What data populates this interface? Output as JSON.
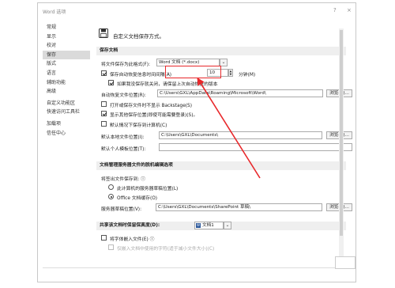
{
  "dialog": {
    "title": "Word 选项",
    "help_glyph": "?",
    "close_glyph": "×"
  },
  "sidebar": {
    "items": [
      {
        "label": "常规",
        "active": false
      },
      {
        "label": "显示",
        "active": false
      },
      {
        "label": "校对",
        "active": false
      },
      {
        "label": "保存",
        "active": true
      },
      {
        "label": "版式",
        "active": false
      },
      {
        "label": "语言",
        "active": false
      },
      {
        "label": "辅助功能",
        "active": false
      },
      {
        "label": "高级",
        "active": false
      },
      {
        "label": "自定义功能区",
        "active": false
      },
      {
        "label": "快速访问工具栏",
        "active": false
      },
      {
        "label": "加载项",
        "active": false
      },
      {
        "label": "信任中心",
        "active": false
      }
    ]
  },
  "header": {
    "text": "自定义文档保存方式。",
    "icon": "save-floppy-icon"
  },
  "save_docs": {
    "section_title": "保存文档",
    "format_label": "将文件保存为此格式(F):",
    "format_value": "Word 文档 (*.docx)",
    "autorecover_label": "保存自动恢复信息时间间隔(A)",
    "autorecover_checked": true,
    "autorecover_minutes": "10",
    "minutes_label": "分钟(M)",
    "keep_last_label": "如果我没保存就关闭，请保留上次自动恢复的版本",
    "keep_last_checked": true,
    "autorecover_location_label": "自动恢复文件位置(R):",
    "autorecover_location_value": "C:\\Users\\GXL\\AppData\\Roaming\\Microsoft\\Word\\",
    "browse_label": "浏览(B)...",
    "no_backstage_label": "打开或保存文件时不显示 Backstage(S)",
    "no_backstage_checked": false,
    "show_other_locations_label": "显示其他保存位置(即使可能需要登录)(S)。",
    "show_other_locations_checked": true,
    "default_to_computer_label": "默认情况下保存到计算机(C)",
    "default_to_computer_checked": false,
    "default_local_label": "默认本地文件位置(I):",
    "default_local_value": "C:\\Users\\GXL\\Documents\\",
    "browse2_label": "浏览(B)...",
    "personal_templates_label": "默认个人模板位置(T):",
    "personal_templates_value": ""
  },
  "server": {
    "section_title": "文档管理服务器文件的脱机编辑选项",
    "checkout_label": "将签出文件保存到: ⓘ",
    "option1_label": "此计算机的服务器草稿位置(L)",
    "option1_selected": false,
    "option2_label": "Office 文档缓存(O)",
    "option2_selected": true,
    "drafts_label": "服务器草稿位置(V):",
    "drafts_value": "C:\\Users\\GXL\\Documents\\SharePoint 草稿\\",
    "browse3_label": "浏览(B)..."
  },
  "fidelity": {
    "section_title": "共享该文档时保留保真度(D):",
    "doc_value": "文档1",
    "embed_fonts_label": "将字体嵌入文件(E) ⓘ",
    "embed_fonts_checked": false,
    "embed_subset_label": "仅嵌入文档中使用的字符(适于减小文件大小)(C)"
  },
  "annotation": {
    "color": "#e8282b"
  }
}
